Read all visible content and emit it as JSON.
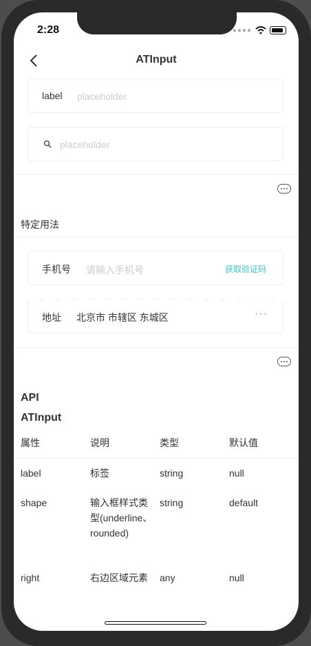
{
  "status_bar": {
    "time": "2:28"
  },
  "nav": {
    "title": "ATInput"
  },
  "basic": {
    "field1_label": "label",
    "field1_placeholder": "placeholder",
    "field2_placeholder": "placeholder"
  },
  "special": {
    "section_title": "特定用法",
    "phone_label": "手机号",
    "phone_placeholder": "请输入手机号",
    "phone_link": "获取验证码",
    "address_label": "地址",
    "address_value": "北京市 市辖区 东城区",
    "address_more": "···"
  },
  "api": {
    "title": "API",
    "component": "ATInput",
    "headers": [
      "属性",
      "说明",
      "类型",
      "默认值"
    ],
    "rows": [
      [
        "label",
        "标签",
        "string",
        "null"
      ],
      [
        "shape",
        "输入框样式类型(underline、rounded)",
        "string",
        "default"
      ],
      [
        "right",
        "右边区域元素",
        "any",
        "null"
      ]
    ]
  }
}
